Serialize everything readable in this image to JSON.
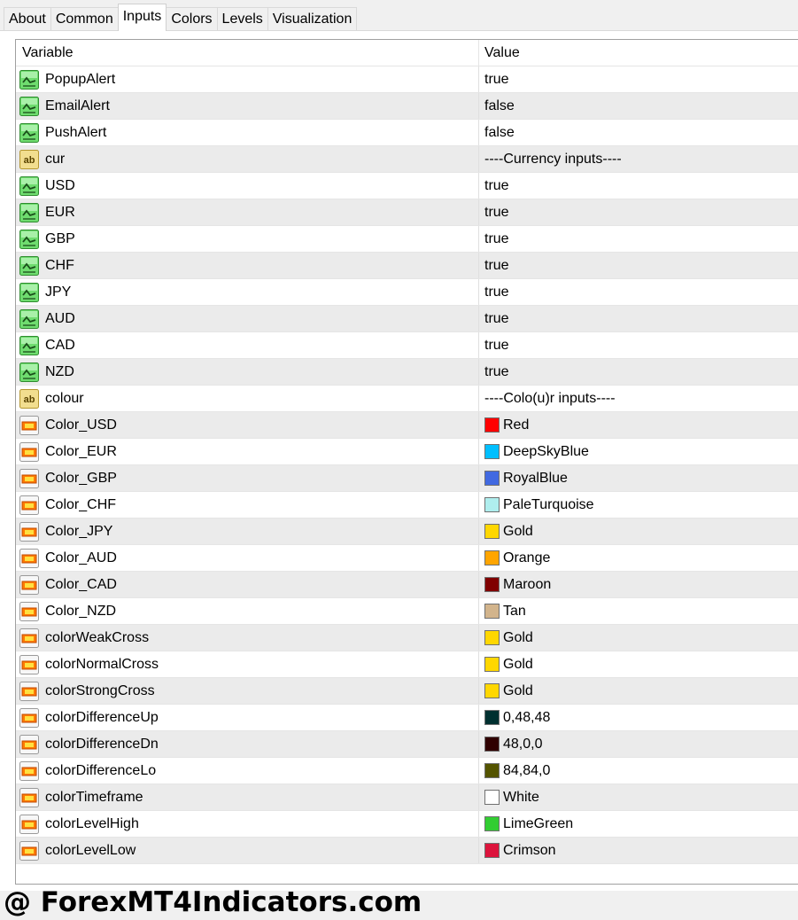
{
  "tabs": [
    {
      "label": "About",
      "active": false
    },
    {
      "label": "Common",
      "active": false
    },
    {
      "label": "Inputs",
      "active": true
    },
    {
      "label": "Colors",
      "active": false
    },
    {
      "label": "Levels",
      "active": false
    },
    {
      "label": "Visualization",
      "active": false
    }
  ],
  "grid": {
    "headers": {
      "variable": "Variable",
      "value": "Value"
    },
    "rows": [
      {
        "icon": "bool-icon",
        "variable": "PopupAlert",
        "value": "true"
      },
      {
        "icon": "bool-icon",
        "variable": "EmailAlert",
        "value": "false"
      },
      {
        "icon": "bool-icon",
        "variable": "PushAlert",
        "value": "false"
      },
      {
        "icon": "string-icon",
        "variable": "cur",
        "value": "----Currency inputs----"
      },
      {
        "icon": "bool-icon",
        "variable": "USD",
        "value": "true"
      },
      {
        "icon": "bool-icon",
        "variable": "EUR",
        "value": "true"
      },
      {
        "icon": "bool-icon",
        "variable": "GBP",
        "value": "true"
      },
      {
        "icon": "bool-icon",
        "variable": "CHF",
        "value": "true"
      },
      {
        "icon": "bool-icon",
        "variable": "JPY",
        "value": "true"
      },
      {
        "icon": "bool-icon",
        "variable": "AUD",
        "value": "true"
      },
      {
        "icon": "bool-icon",
        "variable": "CAD",
        "value": "true"
      },
      {
        "icon": "bool-icon",
        "variable": "NZD",
        "value": "true"
      },
      {
        "icon": "string-icon",
        "variable": "colour",
        "value": "----Colo(u)r inputs----"
      },
      {
        "icon": "color-icon",
        "variable": "Color_USD",
        "value": "Red",
        "swatch": "#FF0000"
      },
      {
        "icon": "color-icon",
        "variable": "Color_EUR",
        "value": "DeepSkyBlue",
        "swatch": "#00BFFF"
      },
      {
        "icon": "color-icon",
        "variable": "Color_GBP",
        "value": "RoyalBlue",
        "swatch": "#4169E1"
      },
      {
        "icon": "color-icon",
        "variable": "Color_CHF",
        "value": "PaleTurquoise",
        "swatch": "#AFEEEE"
      },
      {
        "icon": "color-icon",
        "variable": "Color_JPY",
        "value": "Gold",
        "swatch": "#FFD700"
      },
      {
        "icon": "color-icon",
        "variable": "Color_AUD",
        "value": "Orange",
        "swatch": "#FFA500"
      },
      {
        "icon": "color-icon",
        "variable": "Color_CAD",
        "value": "Maroon",
        "swatch": "#800000"
      },
      {
        "icon": "color-icon",
        "variable": "Color_NZD",
        "value": "Tan",
        "swatch": "#D2B48C"
      },
      {
        "icon": "color-icon",
        "variable": "colorWeakCross",
        "value": "Gold",
        "swatch": "#FFD700"
      },
      {
        "icon": "color-icon",
        "variable": "colorNormalCross",
        "value": "Gold",
        "swatch": "#FFD700"
      },
      {
        "icon": "color-icon",
        "variable": "colorStrongCross",
        "value": "Gold",
        "swatch": "#FFD700"
      },
      {
        "icon": "color-icon",
        "variable": "colorDifferenceUp",
        "value": "0,48,48",
        "swatch": "#003030"
      },
      {
        "icon": "color-icon",
        "variable": "colorDifferenceDn",
        "value": "48,0,0",
        "swatch": "#300000"
      },
      {
        "icon": "color-icon",
        "variable": "colorDifferenceLo",
        "value": "84,84,0",
        "swatch": "#545400"
      },
      {
        "icon": "color-icon",
        "variable": "colorTimeframe",
        "value": "White",
        "swatch": "#FFFFFF"
      },
      {
        "icon": "color-icon",
        "variable": "colorLevelHigh",
        "value": "LimeGreen",
        "swatch": "#32CD32"
      },
      {
        "icon": "color-icon",
        "variable": "colorLevelLow",
        "value": "Crimson",
        "swatch": "#DC143C"
      }
    ]
  },
  "footer": {
    "watermark": "@ ForexMT4Indicators.com"
  }
}
